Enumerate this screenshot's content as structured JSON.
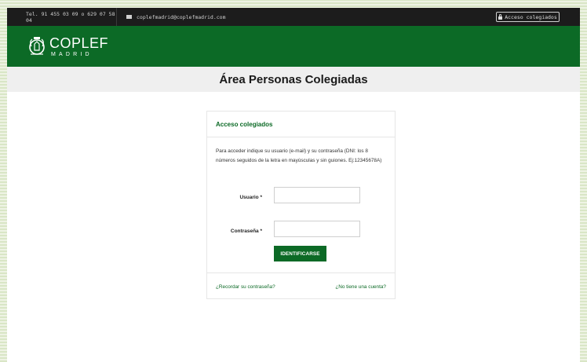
{
  "topbar": {
    "phone": "Tel. 91 455 03 09 o 629 07 58 04",
    "email": "coplefmadrid@coplefmadrid.com",
    "access_label": "Acceso colegiados"
  },
  "logo": {
    "main": "COPLEF",
    "sub": "MADRID"
  },
  "page_title": "Área Personas Colegiadas",
  "login": {
    "heading": "Acceso colegiados",
    "intro": "Para acceder indique su usuario (e-mail) y su contraseña (DNI: los 8 números seguidos de la letra en mayúsculas y sin guiones. Ej:12345678A)",
    "user_label": "Usuario *",
    "user_value": "",
    "password_label": "Contraseña *",
    "password_value": "",
    "submit_label": "IDENTIFICARSE",
    "forgot_link": "¿Recordar su contraseña?",
    "register_link": "¿No tiene una cuenta?"
  },
  "colors": {
    "brand_green": "#0c6a26",
    "topbar_bg": "#1c1c1c",
    "title_band_bg": "#efefef"
  },
  "icons": [
    "envelope-icon",
    "lock-icon",
    "coplef-emblem-icon"
  ]
}
